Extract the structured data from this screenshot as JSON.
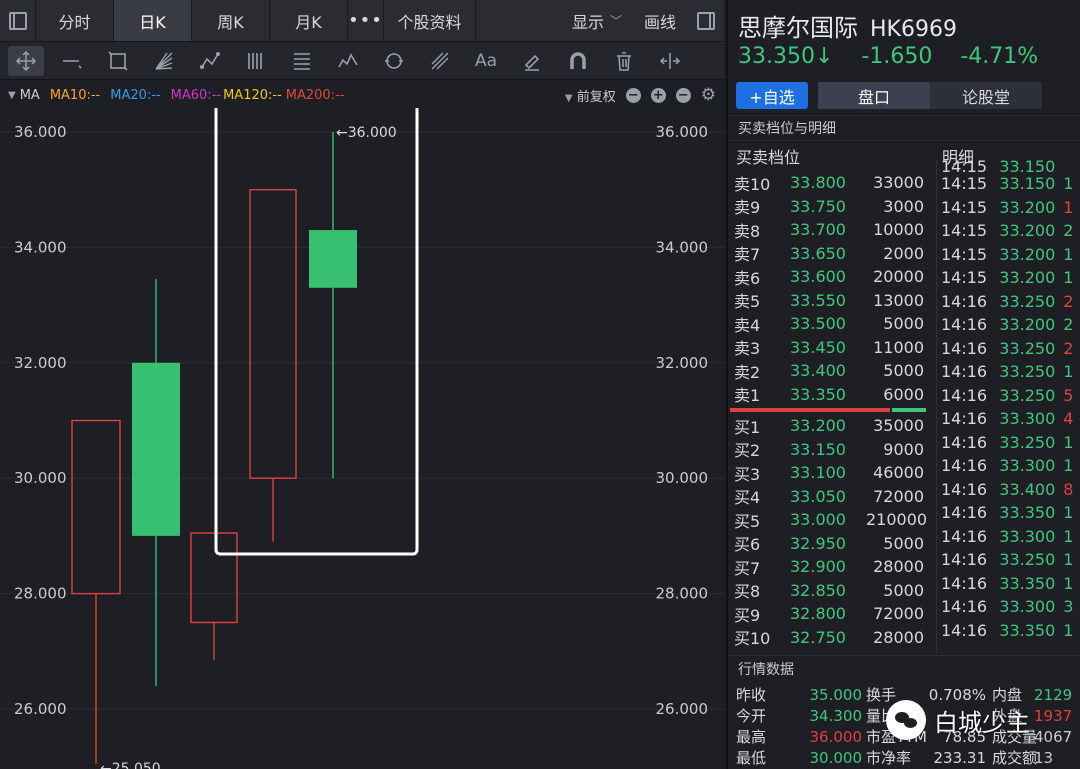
{
  "tabs": {
    "intraday": "分时",
    "daily": "日K",
    "weekly": "周K",
    "monthly": "月K",
    "more": "•••",
    "stock_info": "个股资料",
    "display": "显示",
    "draw": "画线"
  },
  "ma_legend": {
    "label": "MA",
    "items": [
      {
        "text": "MA10:--",
        "color": "#f5a623"
      },
      {
        "text": "MA20:--",
        "color": "#2f9ce8"
      },
      {
        "text": "MA60:--",
        "color": "#d535c8"
      },
      {
        "text": "MA120:--",
        "color": "#f0c419"
      },
      {
        "text": "MA200:--",
        "color": "#e5443a"
      }
    ],
    "adjust": "前复权"
  },
  "chart_data": {
    "type": "candlestick",
    "y_ticks": [
      "36.000",
      "34.000",
      "32.000",
      "30.000",
      "28.000",
      "26.000"
    ],
    "ylim": [
      25.3,
      37.4
    ],
    "candles": [
      {
        "open": 28.0,
        "close": 31.0,
        "high": 31.0,
        "low": 25.05,
        "direction": "up"
      },
      {
        "open": 32.0,
        "close": 29.0,
        "high": 33.45,
        "low": 26.4,
        "direction": "down"
      },
      {
        "open": 27.5,
        "close": 29.05,
        "high": 29.05,
        "low": 26.85,
        "direction": "up"
      },
      {
        "open": 30.0,
        "close": 35.0,
        "high": 35.0,
        "low": 28.9,
        "direction": "up"
      },
      {
        "open": 34.3,
        "close": 33.3,
        "high": 36.0,
        "low": 30.0,
        "direction": "down"
      }
    ],
    "annotations": {
      "high_label": "←36.000",
      "low_label": "←25.050"
    },
    "up_color": "#e0403f",
    "down_color": "#36c06f"
  },
  "stock": {
    "name": "思摩尔国际",
    "code": "HK6969",
    "price": "33.350↓",
    "change": "-1.650",
    "change_pct": "-4.71%"
  },
  "buttons": {
    "watchlist": "+自选",
    "quote_tab": "盘口",
    "forum_tab": "论股堂"
  },
  "orderbook": {
    "section_title": "买卖档位与明细",
    "levels_header": "买卖档位",
    "ticks_header": "明细",
    "asks": [
      {
        "label": "卖10",
        "price": "33.800",
        "vol": "33000"
      },
      {
        "label": "卖9",
        "price": "33.750",
        "vol": "3000"
      },
      {
        "label": "卖8",
        "price": "33.700",
        "vol": "10000"
      },
      {
        "label": "卖7",
        "price": "33.650",
        "vol": "2000"
      },
      {
        "label": "卖6",
        "price": "33.600",
        "vol": "20000"
      },
      {
        "label": "卖5",
        "price": "33.550",
        "vol": "13000"
      },
      {
        "label": "卖4",
        "price": "33.500",
        "vol": "5000"
      },
      {
        "label": "卖3",
        "price": "33.450",
        "vol": "11000"
      },
      {
        "label": "卖2",
        "price": "33.400",
        "vol": "5000"
      },
      {
        "label": "卖1",
        "price": "33.350",
        "vol": "6000"
      }
    ],
    "bids": [
      {
        "label": "买1",
        "price": "33.200",
        "vol": "35000"
      },
      {
        "label": "买2",
        "price": "33.150",
        "vol": "9000"
      },
      {
        "label": "买3",
        "price": "33.100",
        "vol": "46000"
      },
      {
        "label": "买4",
        "price": "33.050",
        "vol": "72000"
      },
      {
        "label": "买5",
        "price": "33.000",
        "vol": "210000"
      },
      {
        "label": "买6",
        "price": "32.950",
        "vol": "5000"
      },
      {
        "label": "买7",
        "price": "32.900",
        "vol": "28000"
      },
      {
        "label": "买8",
        "price": "32.850",
        "vol": "5000"
      },
      {
        "label": "买9",
        "price": "32.800",
        "vol": "72000"
      },
      {
        "label": "买10",
        "price": "32.750",
        "vol": "28000"
      }
    ]
  },
  "ticks": [
    {
      "time": "14:15",
      "price": "33.150",
      "v": ""
    },
    {
      "time": "14:15",
      "price": "33.150",
      "v": "1",
      "red": false
    },
    {
      "time": "14:15",
      "price": "33.200",
      "v": "1",
      "red": true
    },
    {
      "time": "14:15",
      "price": "33.200",
      "v": "2",
      "red": false
    },
    {
      "time": "14:15",
      "price": "33.200",
      "v": "1",
      "red": false
    },
    {
      "time": "14:15",
      "price": "33.200",
      "v": "1",
      "red": false
    },
    {
      "time": "14:16",
      "price": "33.250",
      "v": "2",
      "red": true
    },
    {
      "time": "14:16",
      "price": "33.200",
      "v": "2",
      "red": false
    },
    {
      "time": "14:16",
      "price": "33.250",
      "v": "2",
      "red": true
    },
    {
      "time": "14:16",
      "price": "33.250",
      "v": "1",
      "red": false
    },
    {
      "time": "14:16",
      "price": "33.250",
      "v": "5",
      "red": true
    },
    {
      "time": "14:16",
      "price": "33.300",
      "v": "4",
      "red": true
    },
    {
      "time": "14:16",
      "price": "33.250",
      "v": "1",
      "red": false
    },
    {
      "time": "14:16",
      "price": "33.300",
      "v": "1",
      "red": false
    },
    {
      "time": "14:16",
      "price": "33.400",
      "v": "8",
      "red": true
    },
    {
      "time": "14:16",
      "price": "33.350",
      "v": "1",
      "red": false
    },
    {
      "time": "14:16",
      "price": "33.300",
      "v": "1",
      "red": false
    },
    {
      "time": "14:16",
      "price": "33.250",
      "v": "1",
      "red": false
    },
    {
      "time": "14:16",
      "price": "33.350",
      "v": "1",
      "red": false
    },
    {
      "time": "14:16",
      "price": "33.300",
      "v": "3",
      "red": false
    },
    {
      "time": "14:16",
      "price": "33.350",
      "v": "1",
      "red": false
    }
  ],
  "market_data": {
    "title": "行情数据",
    "rows": [
      {
        "k1": "昨收",
        "v1": "35.000",
        "v1_class": "green",
        "k2": "换手",
        "v2": "0.708%",
        "k3": "内盘",
        "v3": "2129",
        "v3_class": "green"
      },
      {
        "k1": "今开",
        "v1": "34.300",
        "v1_class": "green",
        "k2": "量比",
        "v2": "",
        "k3": "外盘",
        "v3": "1937",
        "v3_class": "red"
      },
      {
        "k1": "最高",
        "v1": "36.000",
        "v1_class": "red",
        "k2": "市盈TTM",
        "v2": "78.85",
        "k3": "成交量",
        "v3": "4067",
        "v3_class": ""
      },
      {
        "k1": "最低",
        "v1": "30.000",
        "v1_class": "green",
        "k2": "市净率",
        "v2": "233.31",
        "k3": "成交额",
        "v3": "13",
        "v3_class": ""
      }
    ]
  },
  "watermark": "白城少主"
}
